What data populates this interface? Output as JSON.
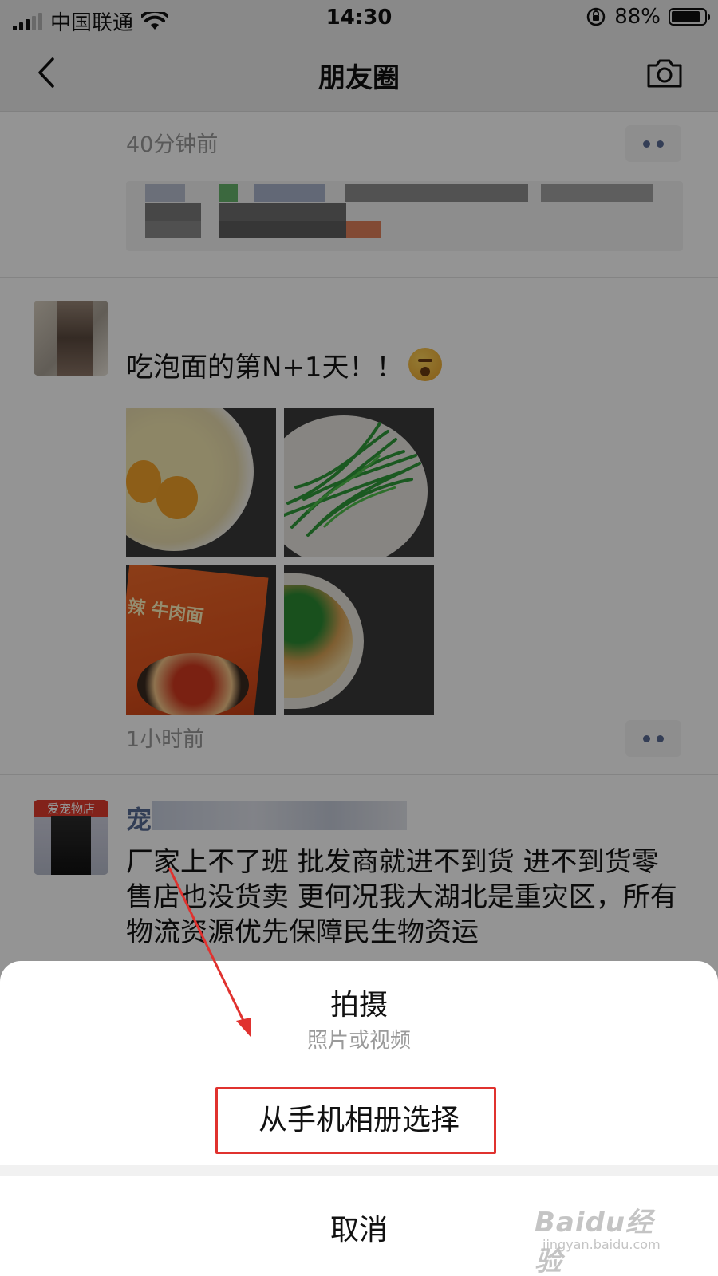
{
  "status_bar": {
    "carrier": "中国联通",
    "time": "14:30",
    "battery_percent": "88%",
    "battery_level": 0.88
  },
  "nav": {
    "title": "朋友圈",
    "back_icon": "chevron-left-icon",
    "camera_icon": "camera-icon"
  },
  "feed": {
    "shared_post": {
      "time": "40分钟前"
    },
    "post_noodle": {
      "text": "吃泡面的第N+1天！！",
      "emoji": "emoji-icon",
      "photo_label": "辣 牛肉面",
      "time": "1小时前"
    },
    "post_shop": {
      "name": "宠",
      "avatar_sign": "爱宠物店",
      "body": "厂家上不了班 批发商就进不到货 进不到货零售店也没货卖 更何况我大湖北是重灾区，所有物流资源优先保障民生物资运"
    }
  },
  "action_sheet": {
    "shoot_label": "拍摄",
    "shoot_sublabel": "照片或视频",
    "album_label": "从手机相册选择",
    "cancel_label": "取消"
  },
  "watermark": {
    "main": "Baidu经验",
    "sub": "jingyan.baidu.com"
  },
  "colors": {
    "link_blue": "#576b95",
    "annotation_red": "#e0322f",
    "nav_bg": "#ededed"
  }
}
